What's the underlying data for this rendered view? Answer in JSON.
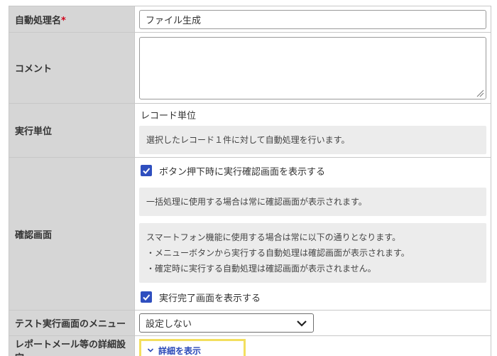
{
  "form": {
    "auto_process_name": {
      "label": "自動処理名",
      "required_mark": "*",
      "value": "ファイル生成"
    },
    "comment": {
      "label": "コメント",
      "value": ""
    },
    "execution_unit": {
      "label": "実行単位",
      "value": "レコード単位",
      "note": "選択したレコード１件に対して自動処理を行います。"
    },
    "confirm_screen": {
      "label": "確認画面",
      "show_confirm_checkbox": {
        "checked": true,
        "label": "ボタン押下時に実行確認画面を表示する"
      },
      "note_bulk": "一括処理に使用する場合は常に確認画面が表示されます。",
      "note_smartphone": {
        "line1": "スマートフォン機能に使用する場合は常に以下の通りとなります。",
        "line2": "・メニューボタンから実行する自動処理は確認画面が表示されます。",
        "line3": "・確定時に実行する自動処理は確認画面が表示されません。"
      },
      "show_complete_checkbox": {
        "checked": true,
        "label": "実行完了画面を表示する"
      }
    },
    "test_menu": {
      "label": "テスト実行画面のメニュー",
      "selected": "設定しない"
    },
    "report_mail": {
      "label": "レポートメール等の詳細設定",
      "link_label": "詳細を表示"
    }
  },
  "colors": {
    "label_bg": "#d6d6d6",
    "checkbox": "#2f4fbf",
    "link": "#2b49b8",
    "highlight": "#f3df5e",
    "required": "#d0021b"
  }
}
